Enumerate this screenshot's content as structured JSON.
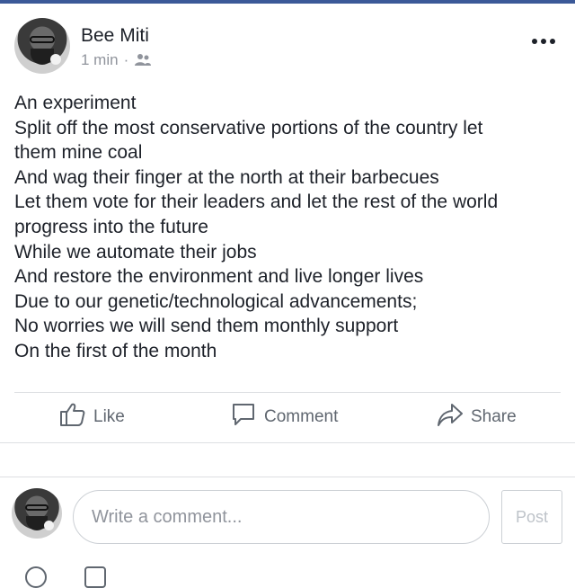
{
  "post": {
    "author": "Bee Miti",
    "time": "1 min",
    "separator": "·",
    "privacy_icon": "friends-icon",
    "more_icon": "more-options-icon",
    "lines": [
      "An experiment",
      "Split off the most conservative portions of the country let",
      "them mine coal",
      "And wag their finger at the north at their barbecues",
      "Let them vote for their leaders and let the rest of the world",
      "progress into the future",
      "While we automate their jobs",
      "And restore the environment and live longer lives",
      "Due to our genetic/technological advancements;",
      "No worries we will send them monthly support",
      "On the first of the month"
    ]
  },
  "actions": {
    "like": "Like",
    "comment": "Comment",
    "share": "Share"
  },
  "comment_box": {
    "placeholder": "Write a comment...",
    "post_label": "Post"
  },
  "colors": {
    "accent_bar": "#3b5998",
    "text": "#1d2129",
    "muted": "#90949c",
    "action": "#606770",
    "border": "#ccd0d5"
  }
}
